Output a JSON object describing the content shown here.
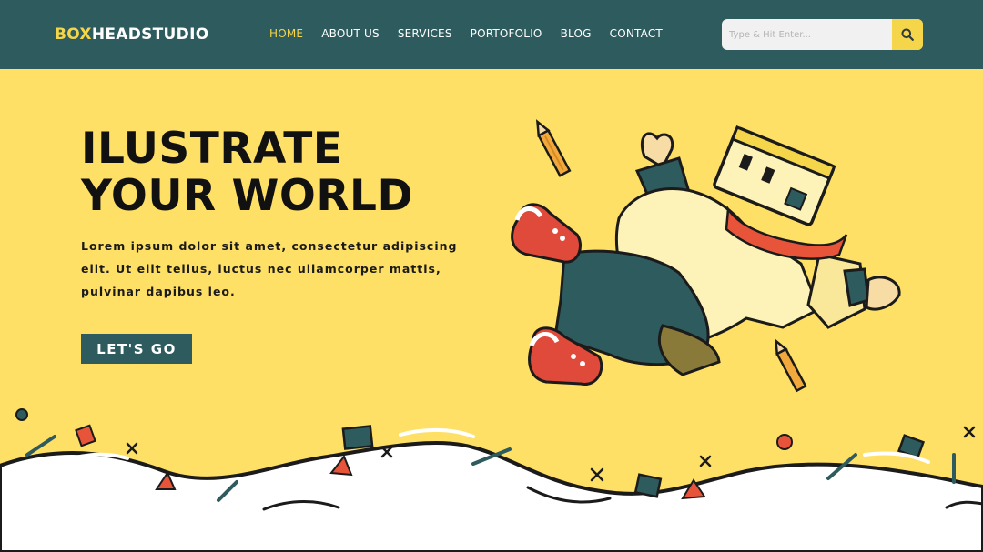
{
  "brand": {
    "part1": "BOX",
    "part2": "HEADSTUDIO"
  },
  "nav": {
    "items": [
      {
        "label": "HOME"
      },
      {
        "label": "ABOUT US"
      },
      {
        "label": "SERVICES"
      },
      {
        "label": "PORTOFOLIO"
      },
      {
        "label": "BLOG"
      },
      {
        "label": "CONTACT"
      }
    ]
  },
  "search": {
    "placeholder": "Type & Hit Enter...",
    "icon": "search-icon"
  },
  "hero": {
    "title_line1": "ILUSTRATE",
    "title_line2": "YOUR WORLD",
    "body_line1": "Lorem ipsum dolor sit amet, consectetur adipiscing",
    "body_line2": "elit. Ut elit tellus, luctus nec ullamcorper mattis,",
    "body_line3": "pulvinar dapibus leo.",
    "cta_label": "LET'S GO"
  },
  "colors": {
    "header": "#2e5b5e",
    "accent": "#f5d54a",
    "background": "#ffe066",
    "text": "#111111"
  }
}
